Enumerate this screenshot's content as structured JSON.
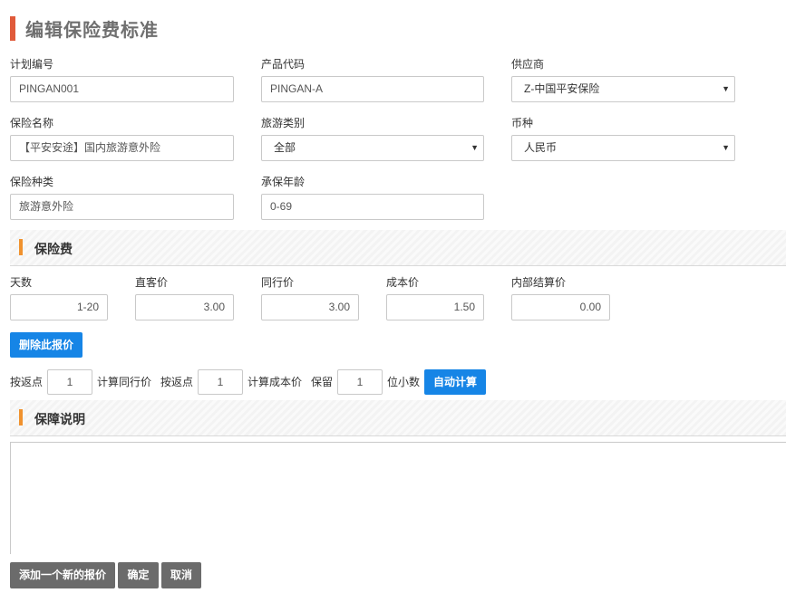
{
  "page": {
    "title": "编辑保险费标准"
  },
  "form": {
    "plan_code": {
      "label": "计划编号",
      "value": "PINGAN001"
    },
    "product_code": {
      "label": "产品代码",
      "value": "PINGAN-A"
    },
    "supplier": {
      "label": "供应商",
      "value": "Z-中国平安保险"
    },
    "insurance_name": {
      "label": "保险名称",
      "value": "【平安安途】国内旅游意外险"
    },
    "travel_type": {
      "label": "旅游类别",
      "value": "全部"
    },
    "currency": {
      "label": "币种",
      "value": "人民币"
    },
    "insurance_kind": {
      "label": "保险种类",
      "value": "旅游意外险"
    },
    "age_range": {
      "label": "承保年龄",
      "value": "0-69"
    }
  },
  "premium": {
    "section_title": "保险费",
    "days": {
      "label": "天数",
      "value": "1-20"
    },
    "direct_price": {
      "label": "直客价",
      "value": "3.00"
    },
    "peer_price": {
      "label": "同行价",
      "value": "3.00"
    },
    "cost_price": {
      "label": "成本价",
      "value": "1.50"
    },
    "internal_price": {
      "label": "内部结算价",
      "value": "0.00"
    },
    "delete_button": "删除此报价"
  },
  "calc": {
    "label_rebate_1": "按返点",
    "rebate_1": "1",
    "label_calc_peer": "计算同行价",
    "label_rebate_2": "按返点",
    "rebate_2": "1",
    "label_calc_cost": "计算成本价",
    "label_keep": "保留",
    "decimals": "1",
    "label_decimals": "位小数",
    "auto_button": "自动计算"
  },
  "coverage": {
    "section_title": "保障说明",
    "text": ""
  },
  "footer": {
    "add_button": "添加一个新的报价",
    "confirm_button": "确定",
    "cancel_button": "取消"
  },
  "colors": {
    "title_mark": "#e05a3a",
    "section_mark": "#f0922f",
    "primary": "#1685e6",
    "secondary": "#6b6b6b"
  }
}
